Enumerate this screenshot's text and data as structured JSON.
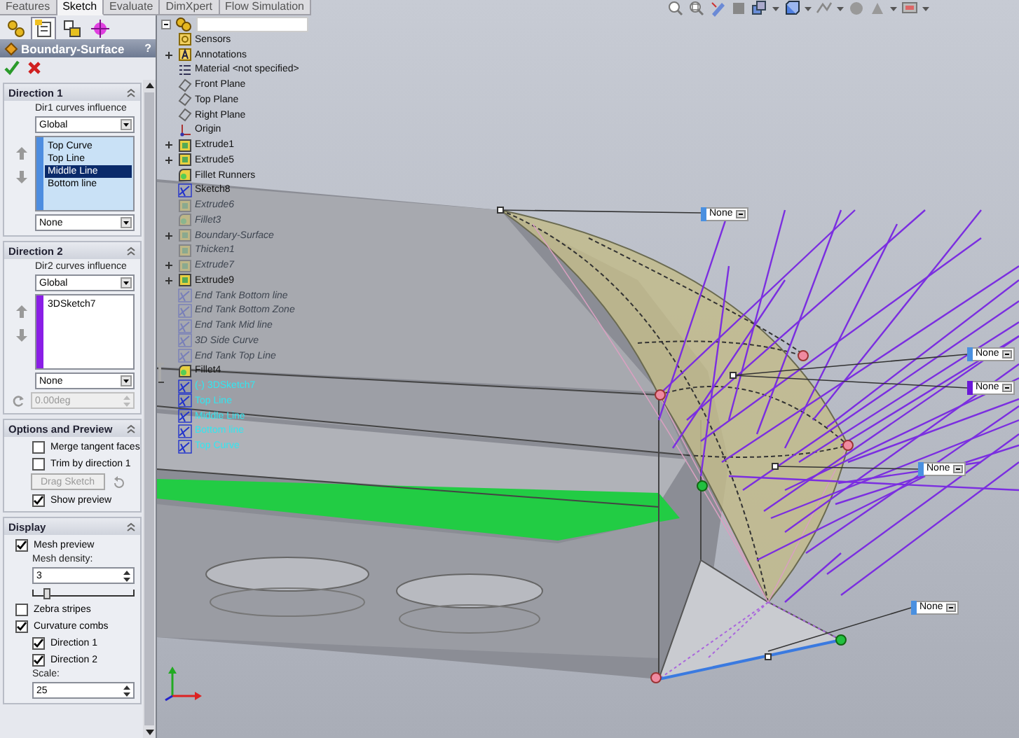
{
  "tabs": [
    {
      "label": "Features",
      "selected": false
    },
    {
      "label": "Sketch",
      "selected": true
    },
    {
      "label": "Evaluate",
      "selected": false
    },
    {
      "label": "DimXpert",
      "selected": false
    },
    {
      "label": "Flow Simulation",
      "selected": false
    }
  ],
  "manager_tabs": [
    {
      "kind": "tree",
      "selected": false
    },
    {
      "kind": "property",
      "selected": true
    },
    {
      "kind": "configuration",
      "selected": false
    },
    {
      "kind": "target",
      "selected": false
    }
  ],
  "property_manager": {
    "title": "Boundary-Surface",
    "help": "?"
  },
  "direction_1": {
    "title": "Direction 1",
    "influence_label": "Dir1 curves influence",
    "influence": "Global",
    "curves": [
      {
        "label": "Top Curve",
        "selected": false
      },
      {
        "label": "Top Line",
        "selected": false
      },
      {
        "label": "Middle Line",
        "selected": true
      },
      {
        "label": "Bottom line",
        "selected": false
      }
    ],
    "tangency": "None"
  },
  "direction_2": {
    "title": "Direction 2",
    "influence_label": "Dir2 curves influence",
    "influence": "Global",
    "curves": [
      {
        "label": "3DSketch7",
        "selected": false
      }
    ],
    "tangency": "None",
    "angle": "0.00deg",
    "angle_disabled": true
  },
  "options": {
    "title": "Options and Preview",
    "items": [
      {
        "kind": "checkbox",
        "label": "Merge tangent faces",
        "checked": false
      },
      {
        "kind": "checkbox",
        "label": "Trim by direction 1",
        "checked": false
      },
      {
        "kind": "button",
        "label": "Drag Sketch",
        "disabled": true
      },
      {
        "kind": "checkbox",
        "label": "Show preview",
        "checked": true
      }
    ]
  },
  "display": {
    "title": "Display",
    "mesh_preview": {
      "label": "Mesh preview",
      "checked": true
    },
    "mesh_density_label": "Mesh density:",
    "mesh_density": "3",
    "mesh_slider": {
      "level": 0.1
    },
    "zebra": {
      "label": "Zebra stripes",
      "checked": false
    },
    "curvature": {
      "label": "Curvature combs",
      "checked": true
    },
    "comb_directions": [
      {
        "label": "Direction 1",
        "checked": true
      },
      {
        "label": "Direction 2",
        "checked": true
      }
    ],
    "scale_label": "Scale:",
    "scale": "25"
  },
  "feature_tree": {
    "items": [
      {
        "label": "Sensors",
        "kind": "sensor",
        "expandable": false,
        "dimmed": false,
        "selected": false
      },
      {
        "label": "Annotations",
        "kind": "annotation",
        "expandable": true,
        "dimmed": false,
        "selected": false
      },
      {
        "label": "Material <not specified>",
        "kind": "material",
        "expandable": false,
        "dimmed": false,
        "selected": false
      },
      {
        "label": "Front Plane",
        "kind": "plane",
        "expandable": false,
        "dimmed": false,
        "selected": false
      },
      {
        "label": "Top Plane",
        "kind": "plane",
        "expandable": false,
        "dimmed": false,
        "selected": false
      },
      {
        "label": "Right Plane",
        "kind": "plane",
        "expandable": false,
        "dimmed": false,
        "selected": false
      },
      {
        "label": "Origin",
        "kind": "origin",
        "expandable": false,
        "dimmed": false,
        "selected": false
      },
      {
        "label": "Extrude1",
        "kind": "feature",
        "expandable": true,
        "dimmed": false,
        "selected": false
      },
      {
        "label": "Extrude5",
        "kind": "feature",
        "expandable": true,
        "dimmed": false,
        "selected": false
      },
      {
        "label": "Fillet Runners",
        "kind": "fillet",
        "expandable": false,
        "dimmed": false,
        "selected": false
      },
      {
        "label": "Sketch8",
        "kind": "sketch",
        "expandable": false,
        "dimmed": false,
        "selected": false
      },
      {
        "label": "Extrude6",
        "kind": "feature",
        "expandable": false,
        "dimmed": true,
        "selected": false
      },
      {
        "label": "Fillet3",
        "kind": "fillet",
        "expandable": false,
        "dimmed": true,
        "selected": false
      },
      {
        "label": "Boundary-Surface",
        "kind": "feature",
        "expandable": true,
        "dimmed": true,
        "selected": false
      },
      {
        "label": "Thicken1",
        "kind": "feature",
        "expandable": false,
        "dimmed": true,
        "selected": false
      },
      {
        "label": "Extrude7",
        "kind": "feature",
        "expandable": true,
        "dimmed": true,
        "selected": false
      },
      {
        "label": "Extrude9",
        "kind": "feature",
        "expandable": true,
        "dimmed": false,
        "selected": false
      },
      {
        "label": "End Tank Bottom line",
        "kind": "sketch",
        "expandable": false,
        "dimmed": true,
        "selected": false
      },
      {
        "label": "End Tank Bottom Zone",
        "kind": "sketch",
        "expandable": false,
        "dimmed": true,
        "selected": false
      },
      {
        "label": "End Tank Mid line",
        "kind": "sketch",
        "expandable": false,
        "dimmed": true,
        "selected": false
      },
      {
        "label": "3D Side Curve",
        "kind": "sketch",
        "expandable": false,
        "dimmed": true,
        "selected": false
      },
      {
        "label": "End Tank Top Line",
        "kind": "sketch",
        "expandable": false,
        "dimmed": true,
        "selected": false
      },
      {
        "label": "Fillet4",
        "kind": "fillet",
        "expandable": false,
        "dimmed": false,
        "selected": false
      },
      {
        "label": "(-) 3DSketch7",
        "kind": "sketch",
        "expandable": false,
        "dimmed": false,
        "selected": true
      },
      {
        "label": "Top Line",
        "kind": "sketch",
        "expandable": false,
        "dimmed": false,
        "selected": true
      },
      {
        "label": "Middle Line",
        "kind": "sketch",
        "expandable": false,
        "dimmed": false,
        "selected": true
      },
      {
        "label": "Bottom line",
        "kind": "sketch",
        "expandable": false,
        "dimmed": false,
        "selected": true
      },
      {
        "label": "Top Curve",
        "kind": "sketch",
        "expandable": false,
        "dimmed": false,
        "selected": true
      }
    ]
  },
  "callouts": [
    {
      "label": "None",
      "active": false
    },
    {
      "label": "None",
      "active": false
    },
    {
      "label": "None",
      "active": true
    },
    {
      "label": "None",
      "active": false
    },
    {
      "label": "None",
      "active": false
    }
  ]
}
